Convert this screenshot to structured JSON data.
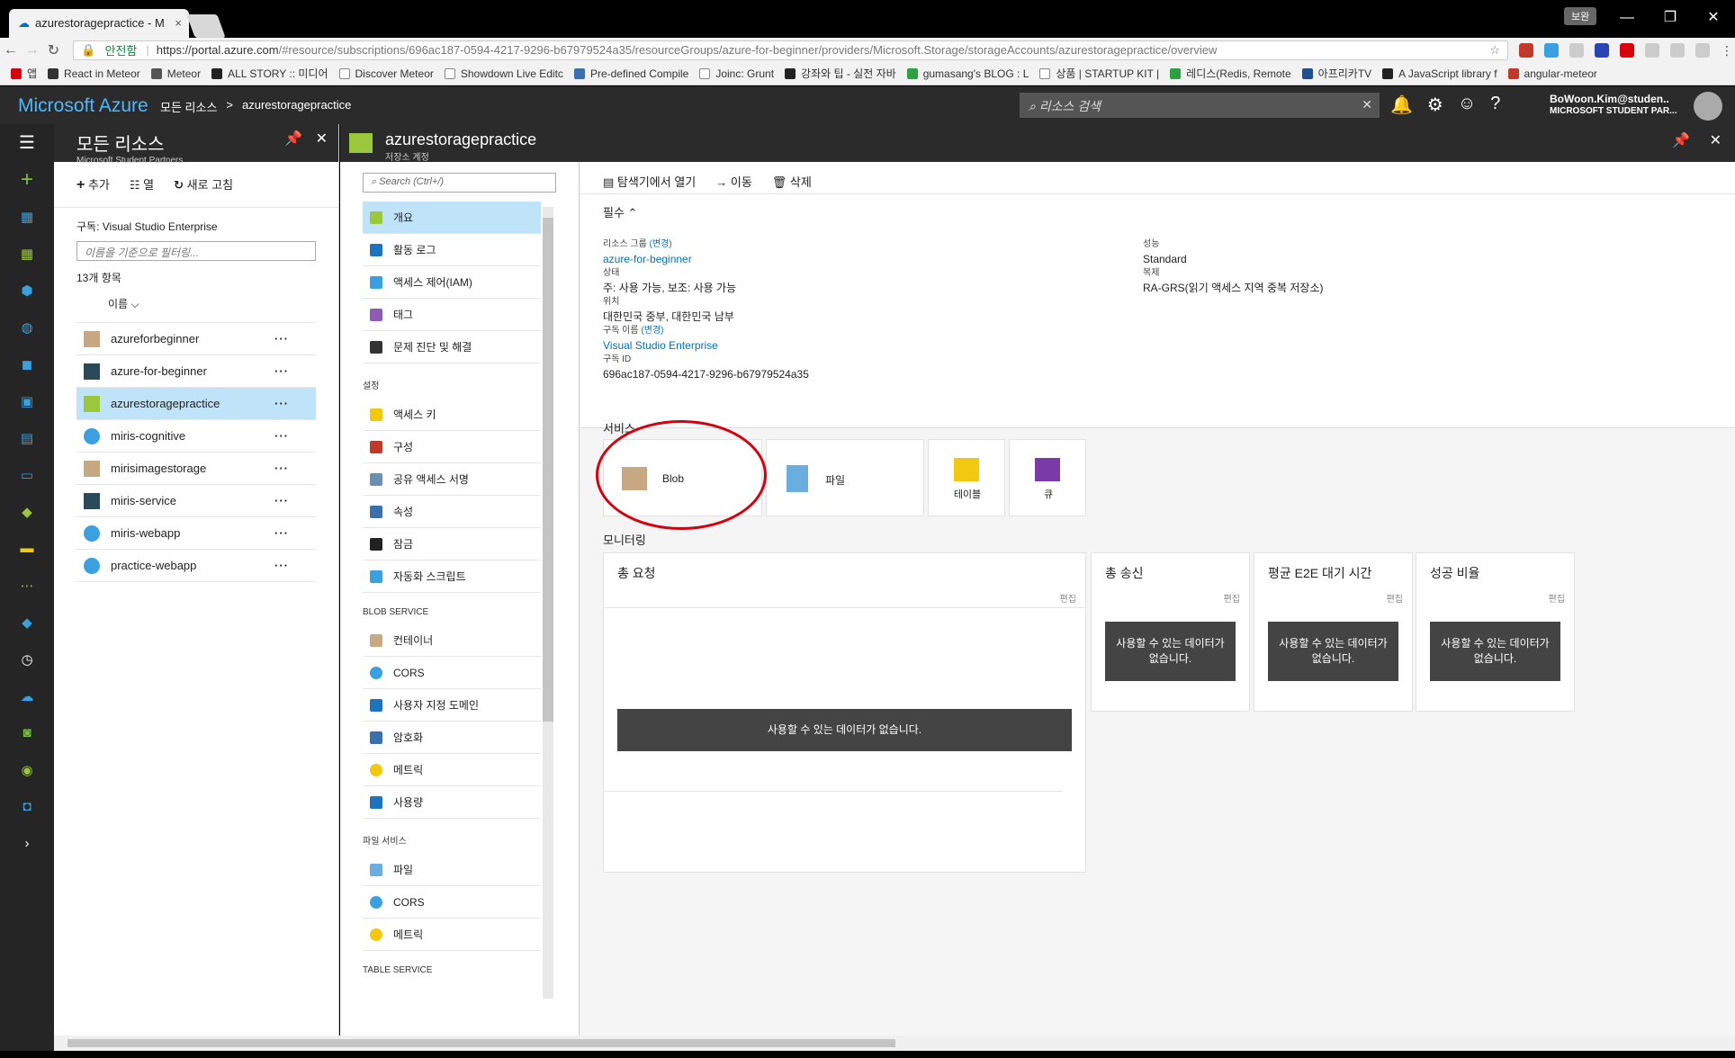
{
  "browser": {
    "tab_title": "azurestoragepractice - M",
    "profile": "보완",
    "secure_label": "안전함",
    "url_host": "https://portal.azure.com",
    "url_path": "/#resource/subscriptions/696ac187-0594-4217-9296-b67979524a35/resourceGroups/azure-for-beginner/providers/Microsoft.Storage/storageAccounts/azurestoragepractice/overview",
    "bookmarks": [
      "앱",
      "React in Meteor",
      "Meteor",
      "ALL STORY :: 미디어",
      "Discover Meteor",
      "Showdown Live Editc",
      "Pre-defined Compile",
      "Joinc: Grunt",
      "강좌와 팁 - 실전 자바",
      "gumasang's BLOG : L",
      "상품 | STARTUP KIT |",
      "레디스(Redis, Remote",
      "아프리카TV",
      "A JavaScript library f",
      "angular-meteor"
    ]
  },
  "azure": {
    "brand": "Microsoft Azure",
    "breadcrumb": [
      "모든 리소스",
      ">",
      "azurestoragepractice"
    ],
    "search_placeholder": "리소스 검색",
    "user_name": "BoWoon.Kim@studen..",
    "user_org": "MICROSOFT STUDENT PAR..."
  },
  "all_resources": {
    "title": "모든 리소스",
    "subtitle": "Microsoft Student Partners",
    "cmd_add": "추가",
    "cmd_columns": "열",
    "cmd_refresh": "새로 고침",
    "subscription": "구독: Visual Studio Enterprise",
    "filter_placeholder": "이름을 기준으로 필터링...",
    "count": "13개 항목",
    "sort": "이름",
    "items": [
      {
        "name": "azureforbeginner",
        "color": "#c8a882"
      },
      {
        "name": "azure-for-beginner",
        "color": "#2a4a5a"
      },
      {
        "name": "azurestoragepractice",
        "color": "#9bc73b"
      },
      {
        "name": "miris-cognitive",
        "color": "#3aa0e0"
      },
      {
        "name": "mirisimagestorage",
        "color": "#c8a882"
      },
      {
        "name": "miris-service",
        "color": "#2a4a5a"
      },
      {
        "name": "miris-webapp",
        "color": "#3aa0e0"
      },
      {
        "name": "practice-webapp",
        "color": "#3aa0e0"
      }
    ]
  },
  "storage": {
    "title": "azurestoragepractice",
    "subtitle": "저장소 계정",
    "menu_search": "Search (Ctrl+/)",
    "menu_top": [
      "개요",
      "활동 로그",
      "액세스 제어(IAM)",
      "태그",
      "문제 진단 및 해결"
    ],
    "section_settings": "설정",
    "menu_settings": [
      "액세스 키",
      "구성",
      "공유 액세스 서명",
      "속성",
      "잠금",
      "자동화 스크립트"
    ],
    "section_blob": "BLOB SERVICE",
    "menu_blob": [
      "컨테이너",
      "CORS",
      "사용자 지정 도메인",
      "암호화",
      "메트릭",
      "사용량"
    ],
    "section_file": "파일 서비스",
    "menu_file": [
      "파일",
      "CORS",
      "메트릭"
    ],
    "section_table": "TABLE SERVICE",
    "toolbar": [
      "탐색기에서 열기",
      "이동",
      "삭제"
    ],
    "essentials_label": "필수",
    "rg_label": "리소스 그룹",
    "change": "(변경)",
    "rg_value": "azure-for-beginner",
    "state_label": "상태",
    "state_value": "주: 사용 가능, 보조: 사용 가능",
    "location_label": "위치",
    "location_value": "대한민국 중부, 대한민국 남부",
    "sub_label": "구독 이름",
    "sub_value": "Visual Studio Enterprise",
    "subid_label": "구독 ID",
    "subid_value": "696ac187-0594-4217-9296-b67979524a35",
    "perf_label": "성능",
    "perf_value": "Standard",
    "rep_label": "복제",
    "rep_value": "RA-GRS(읽기 액세스 지역 중복 저장소)",
    "services_label": "서비스",
    "services": [
      "Blob",
      "파일",
      "테이블",
      "큐"
    ],
    "monitoring_label": "모니터링",
    "mon_total": "총 요청",
    "mon_egress": "총 송신",
    "mon_latency": "평균 E2E 대기 시간",
    "mon_success": "성공 비율",
    "edit": "편집",
    "no_data": "사용할 수 있는 데이터가 없습니다."
  }
}
